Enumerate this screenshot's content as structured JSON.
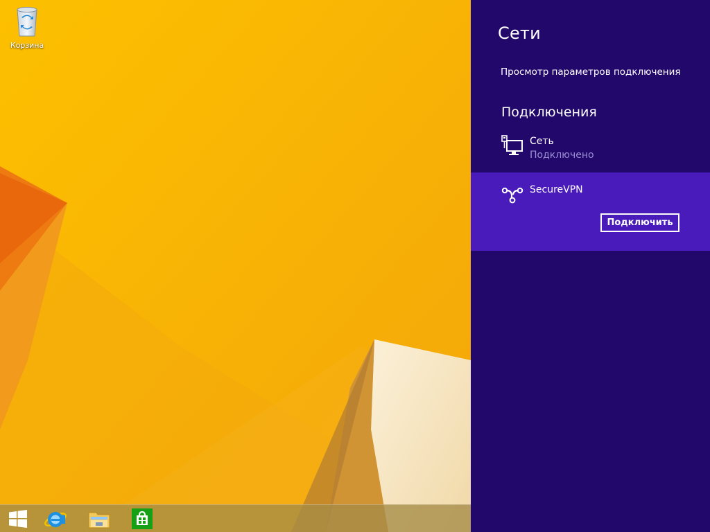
{
  "desktop": {
    "recycle_bin_label": "Корзина",
    "wallpaper_color": "#f7b900"
  },
  "taskbar": {
    "items": [
      {
        "name": "start-button",
        "icon": "windows-logo-icon"
      },
      {
        "name": "internet-explorer",
        "icon": "ie-icon"
      },
      {
        "name": "file-explorer",
        "icon": "folder-icon"
      },
      {
        "name": "store",
        "icon": "store-icon"
      }
    ]
  },
  "charm": {
    "title": "Сети",
    "view_settings_link": "Просмотр параметров подключения",
    "connections_heading": "Подключения",
    "background_color": "#22086a",
    "selected_color": "#4a1bbb",
    "networks": [
      {
        "name": "Сеть",
        "status": "Подключено",
        "icon": "wired-network-icon"
      }
    ],
    "vpn": {
      "name": "SecureVPN",
      "icon": "vpn-icon",
      "connect_label": "Подключить"
    }
  }
}
